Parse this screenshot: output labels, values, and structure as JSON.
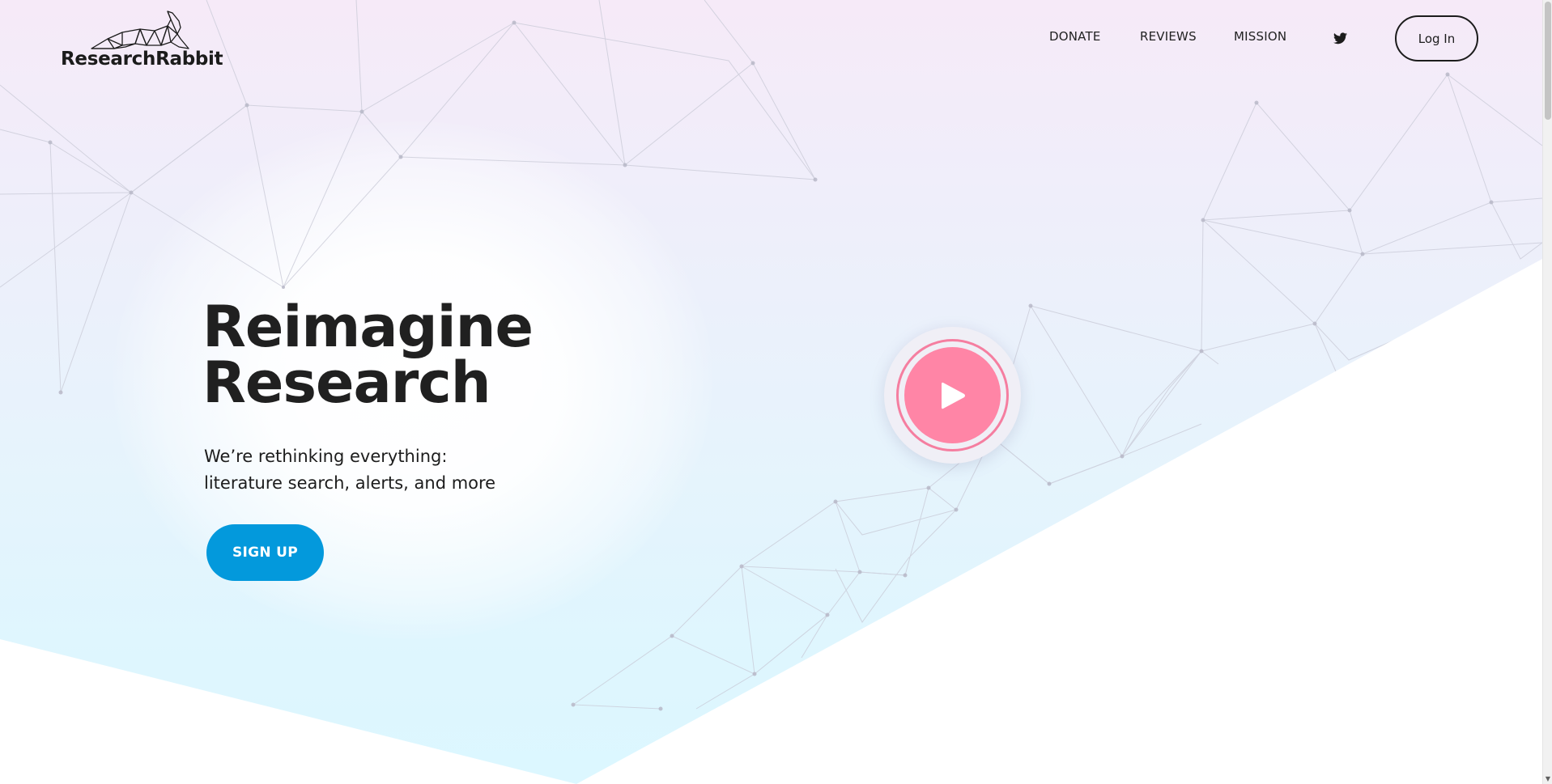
{
  "brand": {
    "name": "ResearchRabbit",
    "logo_icon": "rabbit-logo-icon"
  },
  "nav": {
    "items": [
      {
        "label": "DONATE"
      },
      {
        "label": "REVIEWS"
      },
      {
        "label": "MISSION"
      }
    ],
    "social_icon": "twitter-icon",
    "login_label": "Log In"
  },
  "hero": {
    "title_line1": "Reimagine",
    "title_line2": "Research",
    "subtitle_line1": "We’re rethinking everything:",
    "subtitle_line2": "literature search, alerts, and more",
    "cta_label": "SIGN UP",
    "play_icon": "play-icon"
  },
  "colors": {
    "cta": "#0399dc",
    "play": "#ff85a6",
    "play_ring": "#f57ea0",
    "text": "#202020"
  }
}
